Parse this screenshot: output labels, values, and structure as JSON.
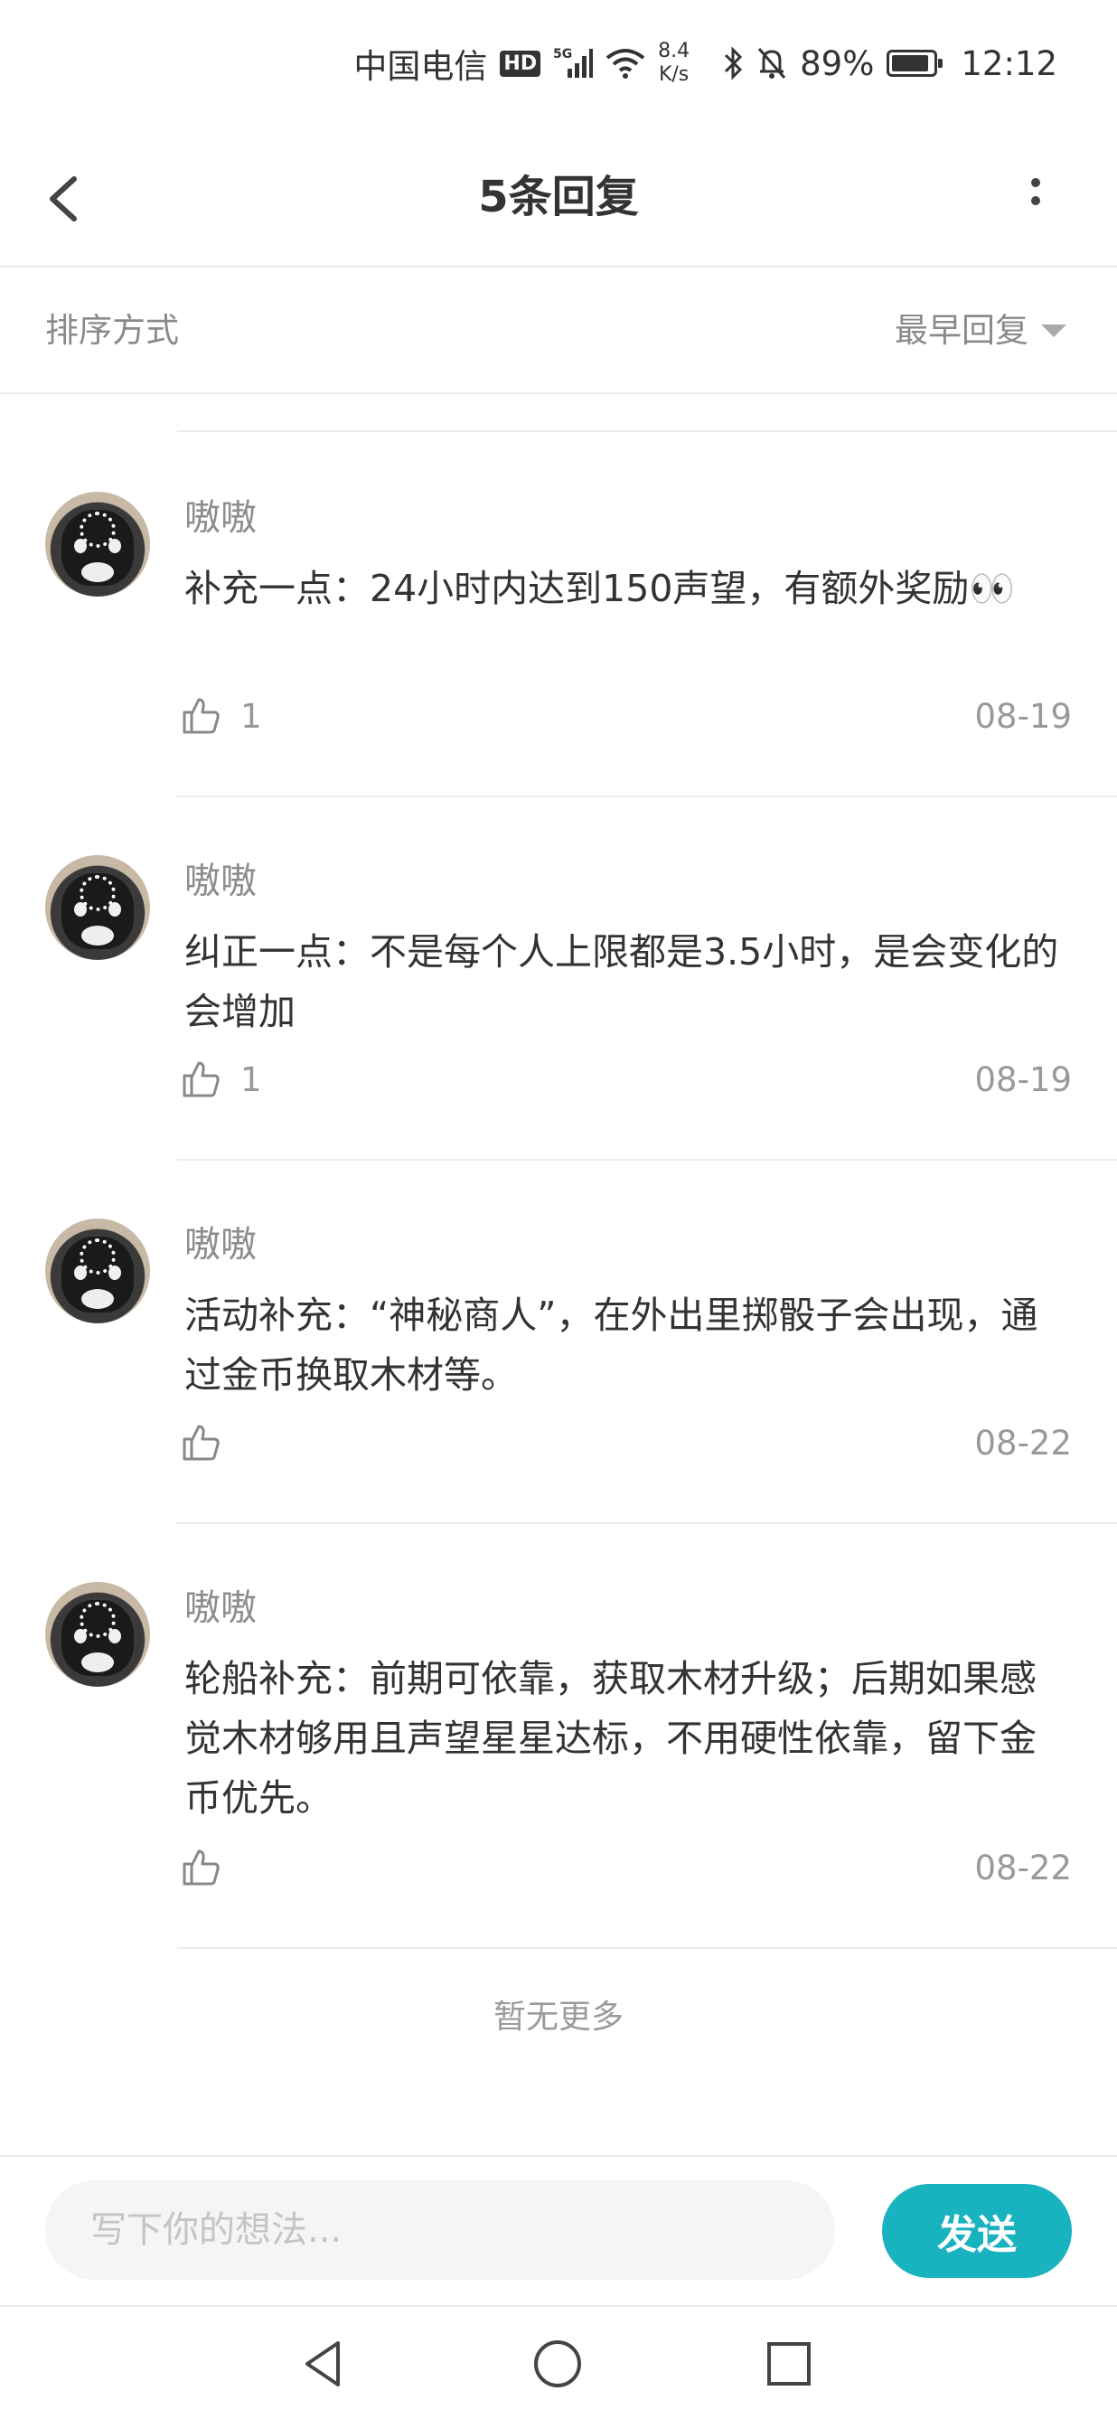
{
  "status_bar": {
    "carrier": "中国电信",
    "hd": "HD",
    "network": "5G",
    "speed_value": "8.4",
    "speed_unit": "K/s",
    "battery": "89%",
    "time": "12:12"
  },
  "header": {
    "title": "5条回复"
  },
  "sort": {
    "label": "排序方式",
    "value": "最早回复"
  },
  "comments": [
    {
      "user": "嗷嗷",
      "text": "补充一点：24小时内达到150声望，有额外奖励👀",
      "likes": "1",
      "date": "08-19"
    },
    {
      "user": "嗷嗷",
      "text": "纠正一点：不是每个人上限都是3.5小时，是会变化的会增加",
      "likes": "1",
      "date": "08-19"
    },
    {
      "user": "嗷嗷",
      "text": "活动补充：“神秘商人”，在外出里掷骰子会出现，通过金币换取木材等。",
      "likes": "",
      "date": "08-22"
    },
    {
      "user": "嗷嗷",
      "text": "轮船补充：前期可依靠，获取木材升级；后期如果感觉木材够用且声望星星达标，不用硬性依靠，留下金币优先。",
      "likes": "",
      "date": "08-22"
    }
  ],
  "no_more": "暂无更多",
  "composer": {
    "placeholder": "写下你的想法...",
    "send_label": "发送"
  },
  "colors": {
    "accent": "#19b3c0"
  }
}
